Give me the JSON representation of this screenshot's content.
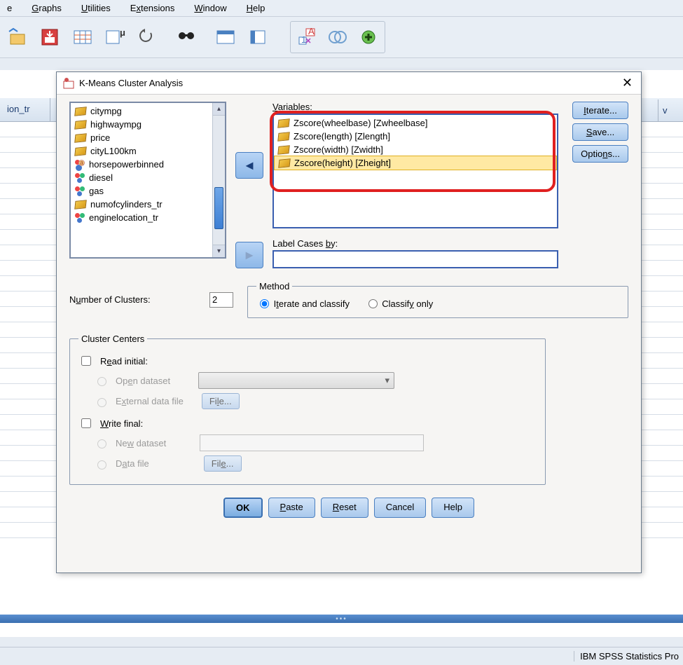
{
  "menu": {
    "items": [
      "e",
      "Graphs",
      "Utilities",
      "Extensions",
      "Window",
      "Help"
    ]
  },
  "sheet": {
    "partial_col_header": "ion_tr",
    "right_col_stub": "v"
  },
  "dialog": {
    "title": "K-Means Cluster Analysis",
    "source_items": [
      {
        "icon": "ruler",
        "label": "citympg"
      },
      {
        "icon": "ruler",
        "label": "highwaympg"
      },
      {
        "icon": "ruler",
        "label": "price"
      },
      {
        "icon": "ruler",
        "label": "cityL100km"
      },
      {
        "icon": "nominal-a",
        "label": "horsepowerbinned"
      },
      {
        "icon": "nominal",
        "label": "diesel"
      },
      {
        "icon": "nominal",
        "label": "gas"
      },
      {
        "icon": "ruler",
        "label": "numofcylinders_tr"
      },
      {
        "icon": "nominal",
        "label": "enginelocation_tr"
      }
    ],
    "variables_label": "Variables:",
    "variables_items": [
      {
        "label": "Zscore(wheelbase) [Zwheelbase]"
      },
      {
        "label": "Zscore(length) [Zlength]"
      },
      {
        "label": "Zscore(width) [Zwidth]"
      },
      {
        "label": "Zscore(height) [Zheight]",
        "selected": true
      }
    ],
    "label_cases_label": "Label Cases by:",
    "num_clusters_label": "Number of Clusters:",
    "num_clusters_value": "2",
    "method": {
      "legend": "Method",
      "iterate": "Iterate and classify",
      "classify": "Classify only"
    },
    "side_buttons": {
      "iterate": "Iterate...",
      "save": "Save...",
      "options": "Options..."
    },
    "centers": {
      "legend": "Cluster Centers",
      "read_initial": "Read initial:",
      "open_dataset": "Open dataset",
      "external_file": "External data file",
      "file_btn": "File...",
      "write_final": "Write final:",
      "new_dataset": "New dataset",
      "data_file": "Data file"
    },
    "buttons": {
      "ok": "OK",
      "paste": "Paste",
      "reset": "Reset",
      "cancel": "Cancel",
      "help": "Help"
    }
  },
  "status": {
    "right": "IBM SPSS Statistics Pro"
  }
}
